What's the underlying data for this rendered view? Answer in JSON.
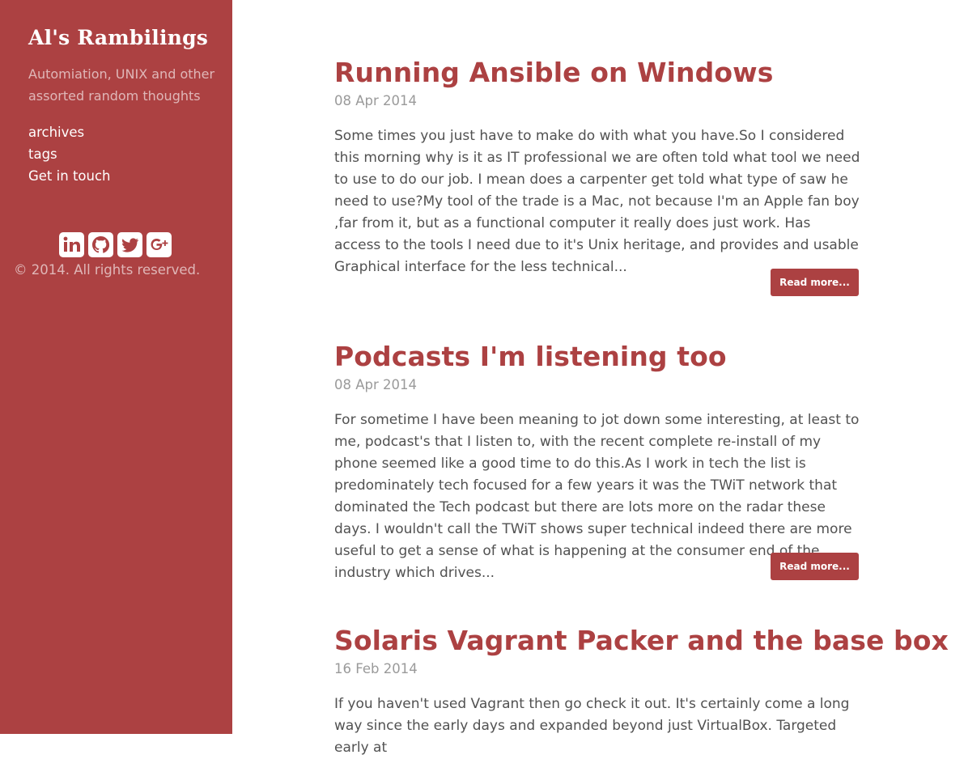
{
  "sidebar": {
    "title": "Al's Rambilings",
    "tagline": "Automiation, UNIX and other assorted random thoughts",
    "nav": [
      {
        "label": "archives"
      },
      {
        "label": "tags"
      },
      {
        "label": "Get in touch"
      }
    ],
    "social": [
      {
        "icon": "linkedin-icon"
      },
      {
        "icon": "github-icon"
      },
      {
        "icon": "twitter-icon"
      },
      {
        "icon": "google-plus-icon"
      }
    ],
    "copyright": "© 2014. All rights reserved."
  },
  "posts": [
    {
      "title": "Running Ansible on Windows",
      "date": "08 Apr 2014",
      "excerpt": "Some times you just have to make do with what you have.So I considered this morning why is it as IT professional we are often told what tool we need to use to do our job. I mean does a carpenter get told what type of saw he need to use?My tool of the trade is a Mac, not because I'm an Apple fan boy ,far from it, but as a functional computer it really does just work. Has access to the tools I need due to it's Unix heritage, and provides and usable Graphical interface for the less technical...",
      "read_more": "Read more..."
    },
    {
      "title": "Podcasts I'm listening too",
      "date": "08 Apr 2014",
      "excerpt": "For sometime I have been meaning to jot down some interesting, at least to me, podcast's that I listen to, with the recent complete re-install of my phone seemed like a good time to do this.As I work in tech the list is predominately tech focused for a few years it was the TWiT network that dominated the Tech podcast but there are lots more on the radar these days. I wouldn't call the TWiT shows super technical indeed there are more useful to get a sense of what is happening at the consumer end of the industry which drives...",
      "read_more": "Read more..."
    },
    {
      "title": "Solaris Vagrant Packer and the base box",
      "date": "16 Feb 2014",
      "excerpt": "If you haven't used Vagrant then go check it out. It's certainly come a long way since the early days and expanded beyond just VirtualBox. Targeted early at"
    }
  ],
  "colors": {
    "accent": "#ac4142",
    "text": "#515151",
    "muted": "#9a9a9a"
  }
}
